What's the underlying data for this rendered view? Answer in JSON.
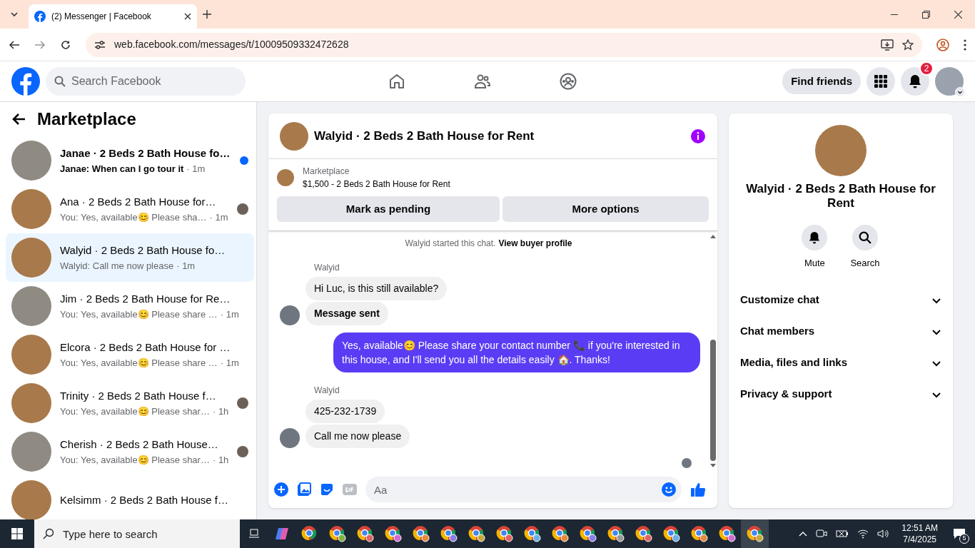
{
  "browser": {
    "tab_title": "(2) Messenger | Facebook",
    "url": "web.facebook.com/messages/t/10009509332472628"
  },
  "header": {
    "search_placeholder": "Search Facebook",
    "find_friends": "Find friends",
    "notification_count": "2"
  },
  "sidebar": {
    "title": "Marketplace",
    "conversations": [
      {
        "title": "Janae · 2 Beds 2 Bath House fo…",
        "preview": "Janae: When can I go tour it",
        "time": "· 1m",
        "unread": true,
        "seen_avatar": false,
        "selected": false
      },
      {
        "title": "Ana · 2 Beds 2 Bath House for…",
        "preview": "You: Yes, available😊 Please sha…",
        "time": "· 1m",
        "unread": false,
        "seen_avatar": true,
        "selected": false
      },
      {
        "title": "Walyid · 2 Beds 2 Bath House fo…",
        "preview": "Walyid: Call me now please",
        "time": "· 1m",
        "unread": false,
        "seen_avatar": false,
        "selected": true
      },
      {
        "title": "Jim · 2 Beds 2 Bath House for Re…",
        "preview": "You: Yes, available😊 Please share …",
        "time": "· 1m",
        "unread": false,
        "seen_avatar": false,
        "selected": false
      },
      {
        "title": "Elcora · 2 Beds 2 Bath House for …",
        "preview": "You: Yes, available😊 Please share …",
        "time": "· 1m",
        "unread": false,
        "seen_avatar": false,
        "selected": false
      },
      {
        "title": "Trinity · 2 Beds 2 Bath House f…",
        "preview": "You: Yes, available😊 Please shar…",
        "time": "· 1h",
        "unread": false,
        "seen_avatar": true,
        "selected": false
      },
      {
        "title": "Cherish · 2 Beds 2 Bath House…",
        "preview": "You: Yes, available😊 Please shar…",
        "time": "· 1h",
        "unread": false,
        "seen_avatar": true,
        "selected": false
      },
      {
        "title": "Kelsimm · 2 Beds 2 Bath House f…",
        "unread": false,
        "seen_avatar": false,
        "selected": false
      }
    ]
  },
  "chat": {
    "title": "Walyid · 2 Beds 2 Bath House for Rent",
    "listing_label": "Marketplace",
    "listing_title": "$1,500 - 2 Beds 2 Bath House for Rent",
    "buttons": [
      "Mark as pending",
      "More options"
    ],
    "messages": [
      {
        "kind": "system",
        "text": "Walyid started this chat.",
        "link": "View buyer profile"
      },
      {
        "kind": "sender",
        "text": "Walyid"
      },
      {
        "kind": "incoming",
        "text": "Hi Luc, is this still available?",
        "avatar": false,
        "bold": false
      },
      {
        "kind": "incoming",
        "text": "Message sent",
        "avatar": true,
        "bold": true
      },
      {
        "kind": "outgoing",
        "text": "Yes, available😊 Please share your contact number 📞 if you're interested in this house, and I'll send you all the details easily 🏠. Thanks!"
      },
      {
        "kind": "sender",
        "text": "Walyid"
      },
      {
        "kind": "incoming",
        "text": "425-232-1739",
        "avatar": false,
        "bold": false
      },
      {
        "kind": "incoming",
        "text": "Call me now please",
        "avatar": true,
        "bold": false
      }
    ],
    "composer_placeholder": "Aa"
  },
  "details": {
    "name": "Walyid · 2 Beds 2 Bath House for Rent",
    "actions": [
      {
        "kind": "mute",
        "label": "Mute"
      },
      {
        "kind": "search",
        "label": "Search"
      }
    ],
    "sections": [
      {
        "label": "Customize chat",
        "expanded": false
      },
      {
        "label": "Chat members",
        "expanded": false
      },
      {
        "label": "Media, files and links",
        "expanded": false
      },
      {
        "label": "Privacy & support",
        "expanded": false
      }
    ]
  },
  "taskbar": {
    "search_placeholder": "Type here to search",
    "time": "12:51 AM",
    "date": "7/4/2025",
    "notification_count": "5"
  }
}
